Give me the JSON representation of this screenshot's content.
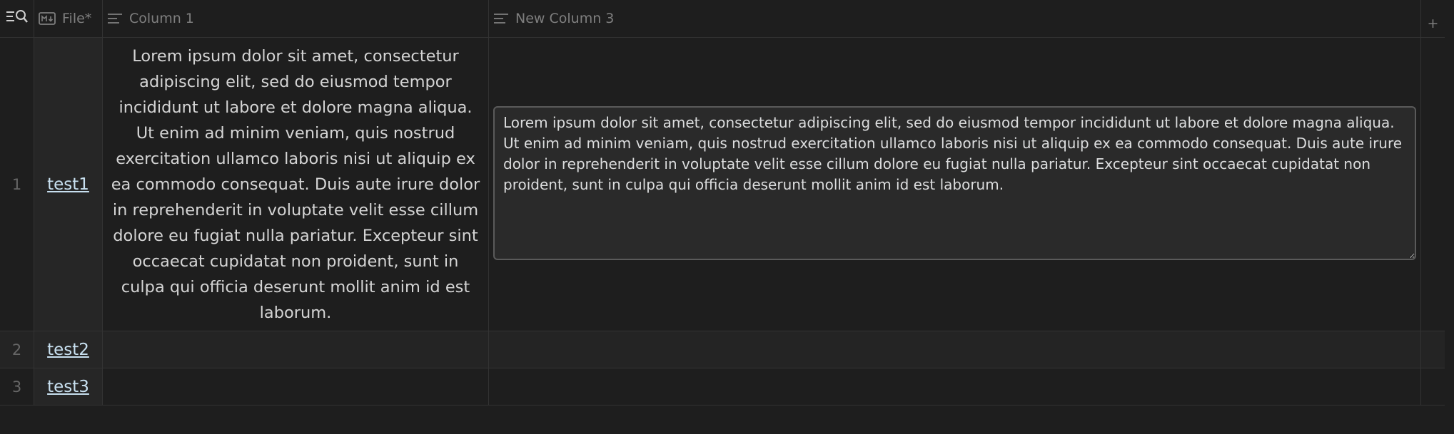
{
  "header": {
    "file_label": "File*",
    "column1_label": "Column 1",
    "column3_label": "New Column 3",
    "add_column_symbol": "+"
  },
  "rows": [
    {
      "number": "1",
      "file": "test1",
      "column1": "Lorem ipsum dolor sit amet, consectetur adipiscing elit, sed do eiusmod tempor incididunt ut labore et dolore magna aliqua. Ut enim ad minim veniam, quis nostrud exercitation ullamco laboris nisi ut aliquip ex ea commodo consequat. Duis aute irure dolor in reprehenderit in voluptate velit esse cillum dolore eu fugiat nulla pariatur. Excepteur sint occaecat cupidatat non proident, sunt in culpa qui officia deserunt mollit anim id est laborum.",
      "column3_editor_value": "Lorem ipsum dolor sit amet, consectetur adipiscing elit, sed do eiusmod tempor incididunt ut labore et dolore magna aliqua. Ut enim ad minim veniam, quis nostrud exercitation ullamco laboris nisi ut aliquip ex ea commodo consequat. Duis aute irure dolor in reprehenderit in voluptate velit esse cillum dolore eu fugiat nulla pariatur. Excepteur sint occaecat cupidatat non proident, sunt in culpa qui officia deserunt mollit anim id est laborum."
    },
    {
      "number": "2",
      "file": "test2"
    },
    {
      "number": "3",
      "file": "test3"
    }
  ],
  "icons": {
    "row_search": "search-list-icon",
    "file_column": "markdown-file-icon",
    "text_column": "text-lines-icon"
  },
  "colors": {
    "background": "#1e1e1e",
    "link": "#c8e0f0",
    "muted": "#7f7f7f",
    "border": "#333333"
  }
}
